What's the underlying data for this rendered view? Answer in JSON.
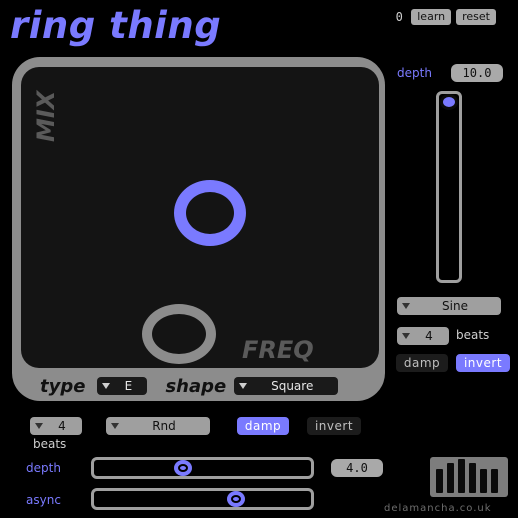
{
  "app": {
    "title": "ring thing"
  },
  "topbar": {
    "counter": "0",
    "learn_label": "learn",
    "reset_label": "reset"
  },
  "pad": {
    "y_label": "MIX",
    "x_label": "FREQ"
  },
  "pad_footer": {
    "type_label": "type",
    "type_value": "E",
    "shape_label": "shape",
    "shape_value": "Square"
  },
  "right_panel": {
    "depth_label": "depth",
    "depth_value": "10.0",
    "depth_level": 0.0,
    "waveform_value": "Sine",
    "beats_value": "4",
    "beats_label": "beats",
    "damp_label": "damp",
    "invert_label": "invert",
    "damp_on": false,
    "invert_on": true
  },
  "bottom_panel": {
    "beats_value": "4",
    "beats_label": "beats",
    "mode_value": "Rnd",
    "damp_label": "damp",
    "invert_label": "invert",
    "damp_on": true,
    "invert_on": false,
    "depth_label": "depth",
    "depth_value": "4.0",
    "depth_level": 0.4,
    "async_label": "async",
    "async_level": 0.67
  },
  "footer": {
    "credit": "delamancha.co.uk"
  },
  "colors": {
    "accent": "#7a7aff",
    "grey": "#8c8c8c",
    "background": "#000000"
  }
}
